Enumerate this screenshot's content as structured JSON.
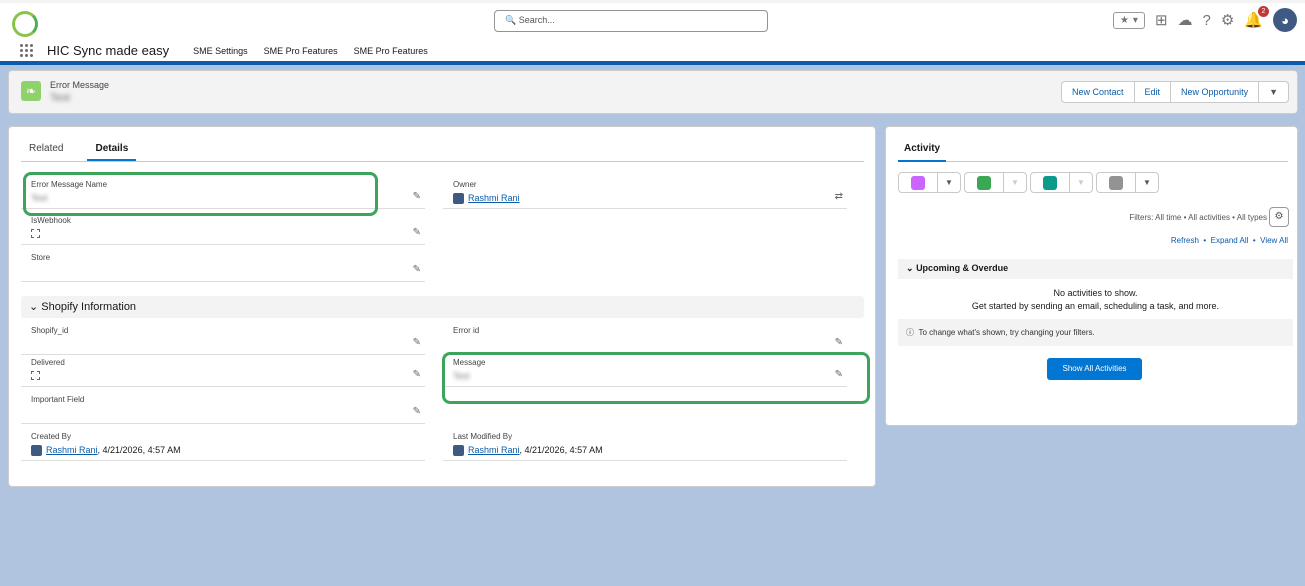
{
  "header": {
    "search_placeholder": "Search...",
    "notification_count": "2"
  },
  "appnav": {
    "app_name": "HIC Sync made easy",
    "tabs": [
      "SME Settings",
      "SME Pro Features",
      "SME Pro Features"
    ]
  },
  "record": {
    "object_label": "Error Message",
    "name": "Test",
    "buttons": [
      "New Contact",
      "Edit",
      "New Opportunity"
    ]
  },
  "details": {
    "tabs": [
      "Related",
      "Details"
    ],
    "fields": {
      "error_message_name": {
        "label": "Error Message Name",
        "value": "Test"
      },
      "owner": {
        "label": "Owner",
        "value": "Rashmi Rani"
      },
      "is_webhook": {
        "label": "IsWebhook"
      },
      "store": {
        "label": "Store"
      },
      "section": "Shopify Information",
      "shopify_id": {
        "label": "Shopify_id"
      },
      "error_id": {
        "label": "Error id"
      },
      "delivered": {
        "label": "Delivered"
      },
      "message": {
        "label": "Message",
        "value": "Test"
      },
      "important_field": {
        "label": "Important Field"
      },
      "created_by": {
        "label": "Created By",
        "user": "Rashmi Rani",
        "date": ", 4/21/2026, 4:57 AM"
      },
      "last_modified_by": {
        "label": "Last Modified By",
        "user": "Rashmi Rani",
        "date": ", 4/21/2026, 4:57 AM"
      }
    }
  },
  "activity": {
    "tab": "Activity",
    "filters": "Filters: All time • All activities • All types",
    "links": [
      "Refresh",
      "Expand All",
      "View All"
    ],
    "upcoming": "Upcoming & Overdue",
    "no_activities": "No activities to show.",
    "get_started": "Get started by sending an email, scheduling a task, and more.",
    "info": "To change what's shown, try changing your filters.",
    "show_all": "Show All Activities"
  }
}
